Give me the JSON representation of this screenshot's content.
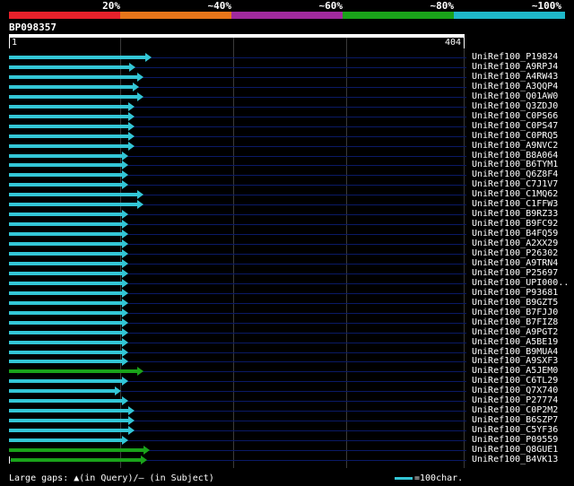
{
  "legend": {
    "segments": [
      {
        "label": "20%",
        "color": "#e8212b"
      },
      {
        "label": "~40%",
        "color": "#e8761a"
      },
      {
        "label": "~60%",
        "color": "#a12a9e"
      },
      {
        "label": "~80%",
        "color": "#1aa31a"
      },
      {
        "label": "~100%",
        "color": "#1fb8c9"
      }
    ]
  },
  "query": {
    "name": "BP098357",
    "start": "1",
    "end": "404"
  },
  "hits": [
    {
      "name": "UniRef100_P19824",
      "end_frac": 0.3,
      "color": "#33c6d6"
    },
    {
      "name": "UniRef100_A9RPJ4",
      "end_frac": 0.265,
      "color": "#33c6d6"
    },
    {
      "name": "UniRef100_A4RW43",
      "end_frac": 0.282,
      "color": "#33c6d6"
    },
    {
      "name": "UniRef100_A3QQP4",
      "end_frac": 0.273,
      "color": "#33c6d6"
    },
    {
      "name": "UniRef100_Q01AW0",
      "end_frac": 0.282,
      "color": "#33c6d6"
    },
    {
      "name": "UniRef100_Q3ZDJ0",
      "end_frac": 0.262,
      "color": "#33c6d6"
    },
    {
      "name": "UniRef100_C0PS66",
      "end_frac": 0.262,
      "color": "#33c6d6"
    },
    {
      "name": "UniRef100_C0PS47",
      "end_frac": 0.262,
      "color": "#33c6d6"
    },
    {
      "name": "UniRef100_C0PRQ5",
      "end_frac": 0.262,
      "color": "#33c6d6"
    },
    {
      "name": "UniRef100_A9NVC2",
      "end_frac": 0.262,
      "color": "#33c6d6"
    },
    {
      "name": "UniRef100_B8A064",
      "end_frac": 0.248,
      "color": "#33c6d6"
    },
    {
      "name": "UniRef100_B6TYM1",
      "end_frac": 0.248,
      "color": "#33c6d6"
    },
    {
      "name": "UniRef100_Q6Z8F4",
      "end_frac": 0.248,
      "color": "#33c6d6"
    },
    {
      "name": "UniRef100_C7J1V7",
      "end_frac": 0.248,
      "color": "#33c6d6"
    },
    {
      "name": "UniRef100_C1MQ62",
      "end_frac": 0.282,
      "color": "#33c6d6"
    },
    {
      "name": "UniRef100_C1FFW3",
      "end_frac": 0.282,
      "color": "#33c6d6"
    },
    {
      "name": "UniRef100_B9RZ33",
      "end_frac": 0.248,
      "color": "#33c6d6"
    },
    {
      "name": "UniRef100_B9FC92",
      "end_frac": 0.248,
      "color": "#33c6d6"
    },
    {
      "name": "UniRef100_B4FQ59",
      "end_frac": 0.248,
      "color": "#33c6d6"
    },
    {
      "name": "UniRef100_A2XX29",
      "end_frac": 0.248,
      "color": "#33c6d6"
    },
    {
      "name": "UniRef100_P26302",
      "end_frac": 0.248,
      "color": "#33c6d6"
    },
    {
      "name": "UniRef100_A9TRN4",
      "end_frac": 0.248,
      "color": "#33c6d6"
    },
    {
      "name": "UniRef100_P25697",
      "end_frac": 0.248,
      "color": "#33c6d6"
    },
    {
      "name": "UniRef100_UPI000..",
      "end_frac": 0.248,
      "color": "#33c6d6"
    },
    {
      "name": "UniRef100_P93681",
      "end_frac": 0.248,
      "color": "#33c6d6"
    },
    {
      "name": "UniRef100_B9GZT5",
      "end_frac": 0.248,
      "color": "#33c6d6"
    },
    {
      "name": "UniRef100_B7FJJ0",
      "end_frac": 0.248,
      "color": "#33c6d6"
    },
    {
      "name": "UniRef100_B7FIZ8",
      "end_frac": 0.248,
      "color": "#33c6d6"
    },
    {
      "name": "UniRef100_A9PGT2",
      "end_frac": 0.248,
      "color": "#33c6d6"
    },
    {
      "name": "UniRef100_A5BE19",
      "end_frac": 0.248,
      "color": "#33c6d6"
    },
    {
      "name": "UniRef100_B9MUA4",
      "end_frac": 0.248,
      "color": "#33c6d6"
    },
    {
      "name": "UniRef100_A9SXF3",
      "end_frac": 0.248,
      "color": "#33c6d6"
    },
    {
      "name": "UniRef100_A5JEM0",
      "end_frac": 0.282,
      "color": "#1aa31a"
    },
    {
      "name": "UniRef100_C6TL29",
      "end_frac": 0.248,
      "color": "#33c6d6"
    },
    {
      "name": "UniRef100_Q7X740",
      "end_frac": 0.232,
      "color": "#33c6d6"
    },
    {
      "name": "UniRef100_P27774",
      "end_frac": 0.248,
      "color": "#33c6d6"
    },
    {
      "name": "UniRef100_C0P2M2",
      "end_frac": 0.262,
      "color": "#33c6d6"
    },
    {
      "name": "UniRef100_B6SZP7",
      "end_frac": 0.262,
      "color": "#33c6d6"
    },
    {
      "name": "UniRef100_C5YF36",
      "end_frac": 0.262,
      "color": "#33c6d6"
    },
    {
      "name": "UniRef100_P09559",
      "end_frac": 0.248,
      "color": "#33c6d6"
    },
    {
      "name": "UniRef100_Q8GUE1",
      "end_frac": 0.296,
      "color": "#1aa31a"
    },
    {
      "name": "UniRef100_B4VK13",
      "end_frac": 0.29,
      "color": "#1aa31a",
      "gap_start": true
    }
  ],
  "footer": {
    "gaps_text": "Large gaps: ▲(in Query)/– (in Subject)",
    "scale_text": "=100char."
  }
}
